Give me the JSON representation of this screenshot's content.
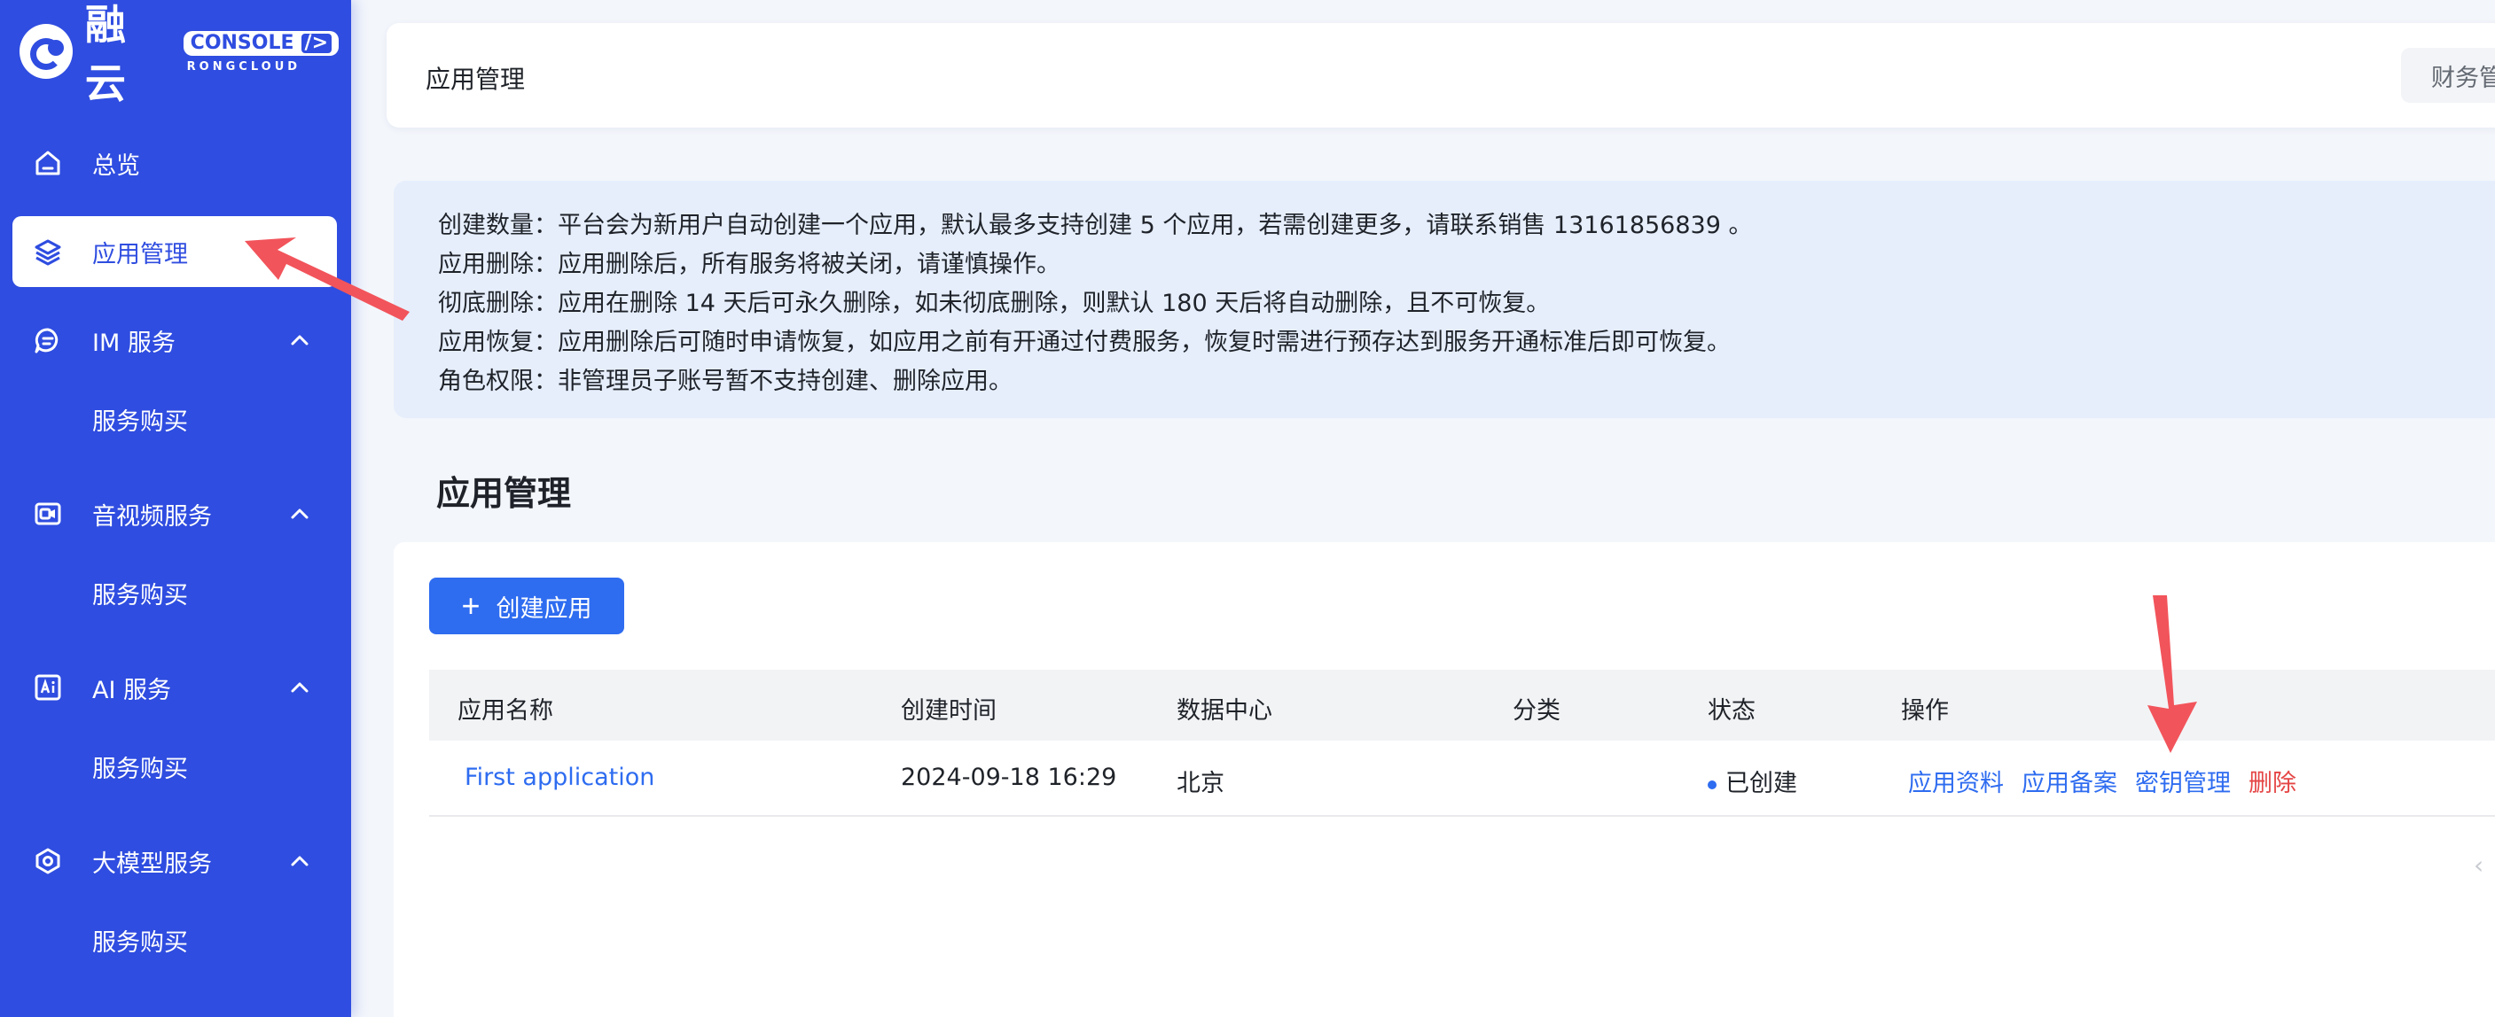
{
  "brand": {
    "name": "融云",
    "console_badge": "CONSOLE",
    "console_slash": "/>",
    "sub": "RONGCLOUD"
  },
  "sidebar": {
    "items": [
      {
        "label": "总览",
        "icon": "home-icon"
      },
      {
        "label": "应用管理",
        "icon": "layers-icon",
        "active": true
      },
      {
        "label": "IM 服务",
        "icon": "chat-icon",
        "sub": "服务购买"
      },
      {
        "label": "音视频服务",
        "icon": "video-icon",
        "sub": "服务购买"
      },
      {
        "label": "AI 服务",
        "icon": "ai-icon",
        "sub": "服务购买"
      },
      {
        "label": "大模型服务",
        "icon": "model-icon",
        "sub": "服务购买"
      }
    ]
  },
  "header": {
    "title": "应用管理",
    "finance": "财务管理"
  },
  "notice": {
    "lines": [
      "创建数量：平台会为新用户自动创建一个应用，默认最多支持创建 5 个应用，若需创建更多，请联系销售 13161856839 。",
      "应用删除：应用删除后，所有服务将被关闭，请谨慎操作。",
      "彻底删除：应用在删除 14 天后可永久删除，如未彻底删除，则默认 180 天后将自动删除，且不可恢复。",
      "应用恢复：应用删除后可随时申请恢复，如应用之前有开通过付费服务，恢复时需进行预存达到服务开通标准后即可恢复。",
      "角色权限：非管理员子账号暂不支持创建、删除应用。"
    ]
  },
  "main": {
    "title": "应用管理",
    "create_label": "创建应用",
    "columns": [
      "应用名称",
      "创建时间",
      "数据中心",
      "分类",
      "状态",
      "操作"
    ],
    "rows": [
      {
        "name": "First application",
        "created": "2024-09-18 16:29",
        "datacenter": "北京",
        "category": "",
        "status": "已创建",
        "actions": [
          "应用资料",
          "应用备案",
          "密钥管理",
          "删除"
        ]
      }
    ]
  },
  "colors": {
    "sidebar": "#2f4de0",
    "primary": "#2e6cf0",
    "danger": "#e54545",
    "annotation_arrow": "#f2545b"
  }
}
